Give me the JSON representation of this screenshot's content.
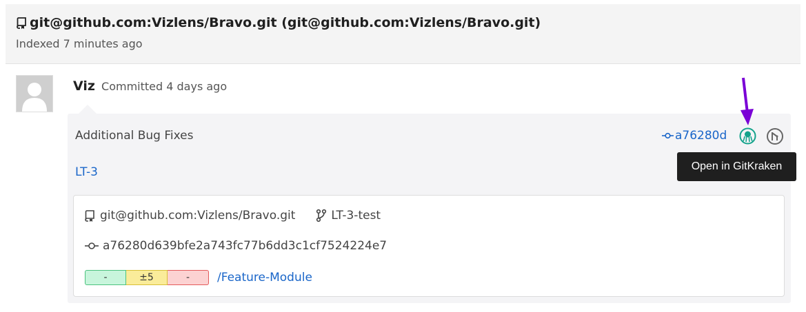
{
  "header": {
    "repo_title": "git@github.com:Vizlens/Bravo.git (git@github.com:Vizlens/Bravo.git)",
    "indexed": "Indexed 7 minutes ago"
  },
  "commit": {
    "author": "Viz",
    "committed": "Committed 4 days ago",
    "message": "Additional Bug Fixes",
    "sha_short": "a76280d",
    "ticket": "LT-3",
    "actions": {
      "gitkraken_icon": "gitkraken-icon",
      "gitlab_icon": "gitlab-icon"
    },
    "details": {
      "repo": "git@github.com:Vizlens/Bravo.git",
      "branch": "LT-3-test",
      "sha_full": "a76280d639bfe2a743fc77b6dd3c1cf7524224e7",
      "diff_added": "-",
      "diff_modified": "±5",
      "diff_deleted": "-",
      "path": "/Feature-Module"
    }
  },
  "tooltip": {
    "text": "Open in GitKraken"
  },
  "colors": {
    "link": "#1a66c9",
    "arrow": "#7a00d6",
    "gitkraken": "#14a38b"
  }
}
